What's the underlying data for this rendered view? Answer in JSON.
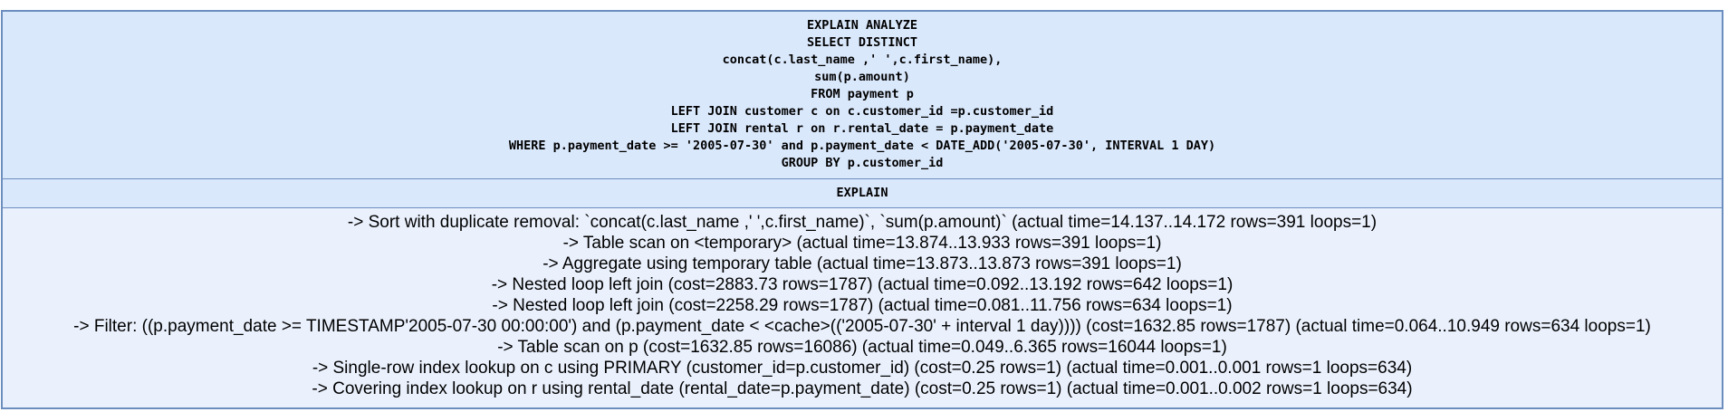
{
  "query": {
    "lines": [
      "EXPLAIN ANALYZE",
      "SELECT DISTINCT",
      "concat(c.last_name ,' ',c.first_name),",
      "sum(p.amount)",
      "FROM payment p",
      "LEFT JOIN customer c on c.customer_id =p.customer_id",
      "LEFT JOIN rental r on r.rental_date = p.payment_date",
      "WHERE p.payment_date >= '2005-07-30' and p.payment_date < DATE_ADD('2005-07-30', INTERVAL 1 DAY)",
      "GROUP BY p.customer_id"
    ]
  },
  "explain": {
    "header": "EXPLAIN"
  },
  "plan": {
    "lines": [
      "-> Sort with duplicate removal: `concat(c.last_name ,' ',c.first_name)`, `sum(p.amount)` (actual time=14.137..14.172 rows=391 loops=1)",
      "-> Table scan on <temporary> (actual time=13.874..13.933 rows=391 loops=1)",
      "-> Aggregate using temporary table (actual time=13.873..13.873 rows=391 loops=1)",
      "-> Nested loop left join (cost=2883.73 rows=1787) (actual time=0.092..13.192 rows=642 loops=1)",
      "-> Nested loop left join (cost=2258.29 rows=1787) (actual time=0.081..11.756 rows=634 loops=1)",
      "-> Filter: ((p.payment_date >= TIMESTAMP'2005-07-30 00:00:00') and (p.payment_date < <cache>(('2005-07-30' + interval 1 day)))) (cost=1632.85 rows=1787) (actual time=0.064..10.949 rows=634 loops=1)",
      "-> Table scan on p (cost=1632.85 rows=16086) (actual time=0.049..6.365 rows=16044 loops=1)",
      "-> Single-row index lookup on c using PRIMARY (customer_id=p.customer_id) (cost=0.25 rows=1) (actual time=0.001..0.001 rows=1 loops=634)",
      "-> Covering index lookup on r using rental_date (rental_date=p.payment_date) (cost=0.25 rows=1) (actual time=0.001..0.002 rows=1 loops=634)"
    ]
  },
  "colors": {
    "border": "#6c8ebf",
    "header_fill": "#dae8fc",
    "body_fill": "#eaf1fd"
  }
}
